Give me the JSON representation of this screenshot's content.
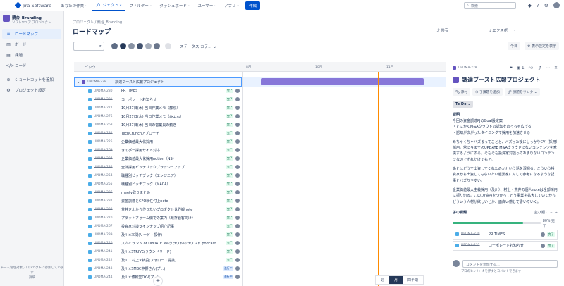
{
  "topbar": {
    "brand": "Jira Software",
    "nav": [
      "あなたの作業",
      "プロジェクト",
      "フィルター",
      "ダッシュボード",
      "ユーザー",
      "アプリ"
    ],
    "active_nav": "プロジェクト",
    "create": "作成",
    "search_placeholder": "検索"
  },
  "sidebar": {
    "project_name": "競合_Branding",
    "project_type": "ソフトウェア プロジェクト",
    "items": [
      {
        "label": "ロードマップ",
        "icon": "≡",
        "active": true
      },
      {
        "label": "ボード",
        "icon": "▥",
        "active": false
      },
      {
        "label": "課題",
        "icon": "▤",
        "active": false
      },
      {
        "label": "コード",
        "icon": "</>",
        "active": false
      },
      {
        "label": "ショートカットを追加",
        "icon": "⊕",
        "active": false
      },
      {
        "label": "プロジェクト設定",
        "icon": "⚙",
        "active": false
      }
    ],
    "footer": "チーム管理対象プロジェクトに参加しています",
    "footer_link": "詳細"
  },
  "header": {
    "breadcrumb": "プロジェクト / 競合_Branding",
    "title": "ロードマップ",
    "share": "共有",
    "export": "エクスポート",
    "status_filter": "ステータス カテ...",
    "today": "今日",
    "settings": "表示設定を表示"
  },
  "table": {
    "epic_header": "エピック",
    "months": [
      "8月",
      "10月",
      "11月"
    ],
    "epic": {
      "key": "UPDMA-228",
      "summary": "調達ブースト広報プロジェクト"
    },
    "rows": [
      {
        "key": "UPDMA-230",
        "summary": "PR TIMES",
        "status": "完了",
        "done": false
      },
      {
        "key": "UPDMA-231",
        "summary": "コーポレートお知らせ",
        "status": "完了",
        "done": true
      },
      {
        "key": "UPDMA-277",
        "summary": "10月27日(木) 当日作業メモ（藤原）",
        "status": "完了",
        "done": false
      },
      {
        "key": "UPDMA-276",
        "summary": "10月27日(木) 当日作業メモ（みょん）",
        "status": "完了",
        "done": false
      },
      {
        "key": "UPDMA-268",
        "summary": "10月27日(木) 当日の営業員の動き",
        "status": "完了",
        "done": true
      },
      {
        "key": "UPDMA-232",
        "summary": "TechCrunchアプローチ",
        "status": "完了",
        "done": true
      },
      {
        "key": "UPDMA-225",
        "summary": "企業価値最大化採用",
        "status": "完了",
        "done": true
      },
      {
        "key": "UPDMA-269",
        "summary": "きのぴー採用サイト対応",
        "status": "完了",
        "done": true
      },
      {
        "key": "UPDMA-234",
        "summary": "企業価値最大化採用notion（NS）",
        "status": "完了",
        "done": true
      },
      {
        "key": "UPDMA-235",
        "summary": "全体採用ピッチブックブラッシュアップ",
        "status": "完了",
        "done": true
      },
      {
        "key": "UPDMA-254",
        "summary": "職種別ピッチブック（エンジニア）",
        "status": "完了",
        "done": false
      },
      {
        "key": "UPDMA-255",
        "summary": "職種別ピッチブック（MACA）",
        "status": "完了",
        "done": false
      },
      {
        "key": "UPDMA-236",
        "summary": "meety取りまとめ",
        "status": "完了",
        "done": true
      },
      {
        "key": "UPDMA-237",
        "summary": "資金調達とCFO就任付上note",
        "status": "完了",
        "done": true
      },
      {
        "key": "UPDMA-238",
        "summary": "荒井さんから作りたいプロダクト世界観note",
        "status": "完了",
        "done": true
      },
      {
        "key": "UPDMA-270",
        "summary": "プラットフォーム側での案内（既存顧客向け）",
        "status": "完了",
        "done": true
      },
      {
        "key": "UPDMA-267",
        "summary": "投資家対談ラインナップ紹介記事",
        "status": "完了",
        "done": false
      },
      {
        "key": "UPDMA-239",
        "summary": "及川×本間(リード・投作)",
        "status": "完了",
        "done": true
      },
      {
        "key": "UPDMA-240",
        "summary": "スカイランド or UPDATE M&クラウドのラウンド podcast...",
        "status": "完了",
        "done": true
      },
      {
        "key": "UPDMA-241",
        "summary": "及川×STRIVE(ラウンドリード)",
        "status": "完了",
        "done": false
      },
      {
        "key": "UPDMA-242",
        "summary": "及川・村上×新設(フォロー・提携)",
        "status": "完了",
        "done": false
      },
      {
        "key": "UPDMA-243",
        "summary": "及川×SMBC中野さん(プ...)",
        "status": "進行中",
        "done": false
      },
      {
        "key": "UPDMA-244",
        "summary": "及川×博報堂DYV(プ...)",
        "status": "進行中",
        "done": false
      }
    ],
    "zoom": [
      "週",
      "月",
      "四半期"
    ],
    "zoom_active": "月"
  },
  "panel": {
    "key": "UPDMA-228",
    "watch_count": "1",
    "title": "調達ブースト広報プロジェクト",
    "actions": [
      "添付",
      "子課題を追加",
      "課題をリンク"
    ],
    "status": "To Do",
    "desc_label": "説明",
    "desc": [
      "今回の資金調達PJのGoal設定案\n・とにかくM&Aクラウドの認知をめっちゃ広げる\n・認知が広がったタイミングで採用を加速させる",
      "めちゃくちゃバズるってことと、バズった後にしっかりCV（採用）採用。常に今までのUPDATE M&Aクラウドにないコンテンツを意識するようにする。そもそも投資家対談ってあまりないコンテンツなのでそれだけでもア。",
      "あとはどうで出資してくれたのかという話を深掘る。こういう投資家から出資してもらいたい起業家に対して参考になるような記事とバズりやすい。",
      "企業価値最大主義採用（及川）、村上・荒井の個人noteは全部採用に振り切る。この10億円をつかってどう事業を拡大していくからどういう人材が欲しいとか、面白い感じで書いていく。"
    ],
    "children_label": "子の課題",
    "sort_label": "並び順",
    "progress_text": "80% 完了",
    "progress": 0.8,
    "children": [
      {
        "key": "UPDMA-230",
        "summary": "PR TIMES",
        "status": "完了"
      },
      {
        "key": "UPDMA-231",
        "summary": "コーポレートお知らせ",
        "status": "完了"
      }
    ],
    "comment_placeholder": "コメントを追加する...",
    "tip": "プロのヒント: M を押すとコメントできます"
  }
}
